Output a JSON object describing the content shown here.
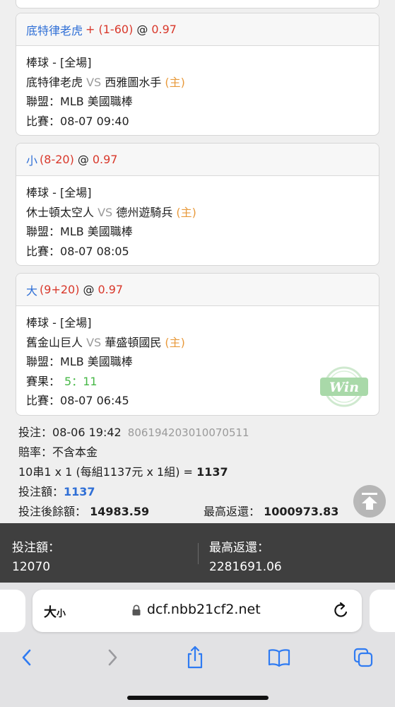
{
  "bets": [
    {
      "pick": "底特律老虎",
      "handicap": "+ (1-60)",
      "at": "@",
      "odds": "0.97",
      "sport": "棒球 - [全場]",
      "team_away": "底特律老虎",
      "vs": "VS",
      "team_home": "西雅圖水手",
      "home_tag": "(主)",
      "league_label": "聯盟：",
      "league": "MLB 美國職棒",
      "match_label": "比賽：",
      "match_time": "08-07 09:40"
    },
    {
      "pick": "小",
      "handicap": "(8-20)",
      "at": "@",
      "odds": "0.97",
      "sport": "棒球 - [全場]",
      "team_away": "休士頓太空人",
      "vs": "VS",
      "team_home": "德州遊騎兵",
      "home_tag": "(主)",
      "league_label": "聯盟：",
      "league": "MLB 美國職棒",
      "match_label": "比賽：",
      "match_time": "08-07 08:05"
    },
    {
      "pick": "大",
      "handicap": "(9+20)",
      "at": "@",
      "odds": "0.97",
      "sport": "棒球 - [全場]",
      "team_away": "舊金山巨人",
      "vs": "VS",
      "team_home": "華盛頓國民",
      "home_tag": "(主)",
      "league_label": "聯盟：",
      "league": "MLB 美國職棒",
      "result_label": "賽果：",
      "result": "5：11",
      "stamp": "Win",
      "match_label": "比賽：",
      "match_time": "08-07 06:45"
    }
  ],
  "summary": {
    "bet_label": "投注：",
    "bet_time": "08-06 19:42",
    "order_no": "806194203010070511",
    "rate_label": "賠率：",
    "rate": "不含本金",
    "combo_prefix": "10串1 x 1 (每組1137元 x 1組) = ",
    "combo_total": "1137",
    "amount_label": "投注額：",
    "amount": "1137",
    "balance_label": "投注後餘額：",
    "balance": "14983.59",
    "max_return_label": "最高返還：",
    "max_return": "1000973.83"
  },
  "totals": {
    "amount_label": "投注額：",
    "amount": "12070",
    "max_return_label": "最高返還：",
    "max_return": "2281691.06"
  },
  "browser": {
    "text_size_big": "大",
    "text_size_small": "小",
    "url": "dcf.nbb21cf2.net"
  },
  "colors": {
    "pick_blue": "#2f6fd6",
    "odds_red": "#d9382b",
    "home_orange": "#e89a3c",
    "result_green": "#47b847",
    "totals_bar": "#3f3f3f"
  }
}
